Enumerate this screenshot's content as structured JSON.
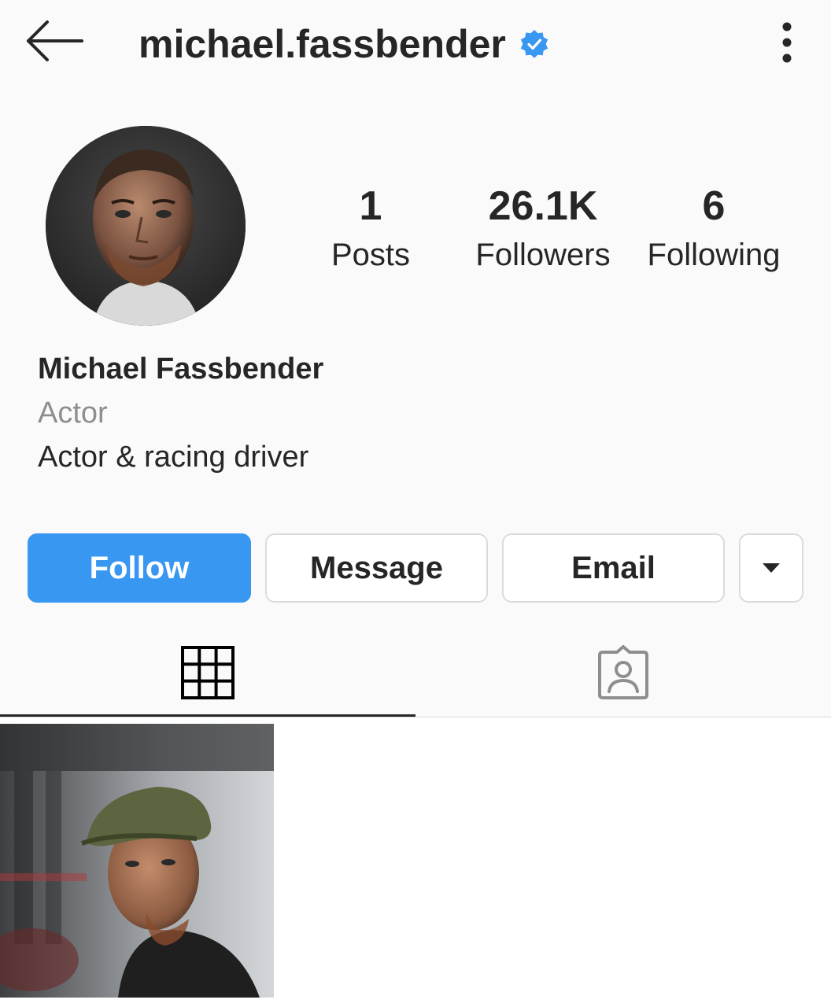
{
  "header": {
    "username": "michael.fassbender",
    "verified": true,
    "back_icon": "arrow-left-icon",
    "more_icon": "more-vertical-icon"
  },
  "profile": {
    "stats": [
      {
        "value": "1",
        "label": "Posts"
      },
      {
        "value": "26.1K",
        "label": "Followers"
      },
      {
        "value": "6",
        "label": "Following"
      }
    ],
    "full_name": "Michael Fassbender",
    "category": "Actor",
    "bio": "Actor & racing driver"
  },
  "actions": {
    "follow_label": "Follow",
    "message_label": "Message",
    "email_label": "Email",
    "dropdown_icon": "caret-down-icon"
  },
  "tabs": [
    {
      "icon": "grid-icon",
      "active": true
    },
    {
      "icon": "tagged-icon",
      "active": false
    }
  ],
  "colors": {
    "accent": "#3897f0",
    "verified_badge": "#3897f0",
    "text_primary": "#262626",
    "text_secondary": "#8e8e8e",
    "border": "#dbdbdb",
    "background": "#fafafa"
  }
}
